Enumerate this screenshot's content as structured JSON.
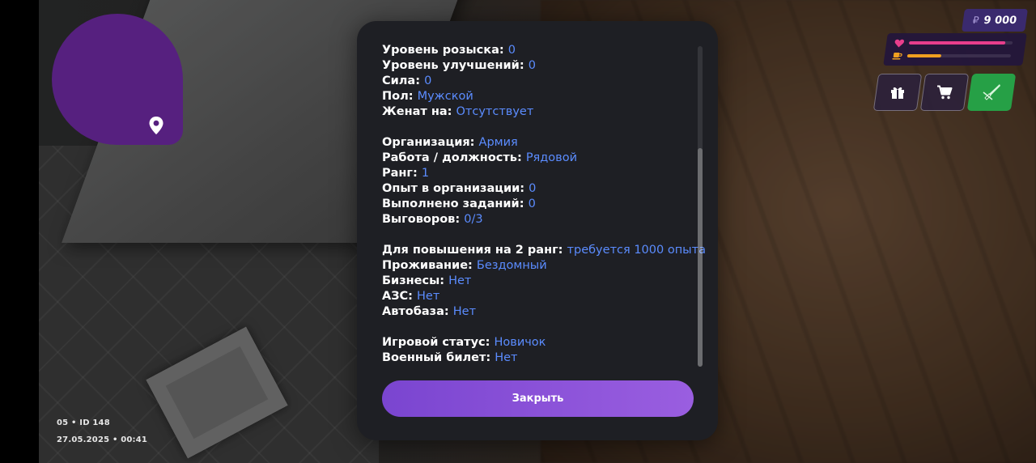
{
  "hud": {
    "currency_symbol": "₽",
    "money": "9 000",
    "health_level": 0.93,
    "hunger_level": 0.33,
    "buttons": {
      "gift_icon": "gift-icon",
      "shop_icon": "cart-icon",
      "weapon_icon": "knife-icon"
    },
    "server_line": "05 • ID 148",
    "datetime": "27.05.2025 • 00:41"
  },
  "stats": [
    {
      "label": "Уровень розыска:",
      "value": "0"
    },
    {
      "label": "Уровень улучшений:",
      "value": "0"
    },
    {
      "label": "Сила:",
      "value": "0"
    },
    {
      "label": "Пол:",
      "value": "Мужской"
    },
    {
      "label": "Женат на:",
      "value": "Отсутствует"
    },
    null,
    {
      "label": "Организация:",
      "value": "Армия"
    },
    {
      "label": "Работа / должность:",
      "value": "Рядовой"
    },
    {
      "label": "Ранг:",
      "value": "1"
    },
    {
      "label": "Опыт в организации:",
      "value": "0"
    },
    {
      "label": "Выполнено заданий:",
      "value": "0"
    },
    {
      "label": "Выговоров:",
      "value": "0/3"
    },
    null,
    {
      "label": "Для повышения на 2 ранг:",
      "value": "требуется 1000 опыта"
    },
    {
      "label": "Проживание:",
      "value": "Бездомный"
    },
    {
      "label": "Бизнесы:",
      "value": "Нет"
    },
    {
      "label": "АЗС:",
      "value": "Нет"
    },
    {
      "label": "Автобаза:",
      "value": "Нет"
    },
    null,
    {
      "label": "Игровой статус:",
      "value": "Новичок"
    },
    {
      "label": "Военный билет:",
      "value": "Нет"
    }
  ],
  "modal": {
    "close_label": "Закрыть"
  },
  "colors": {
    "accent": "#5b8cff",
    "button": "#8a52d8",
    "health": "#e83e8c",
    "hunger": "#f0a020",
    "minimap": "#56207f"
  }
}
